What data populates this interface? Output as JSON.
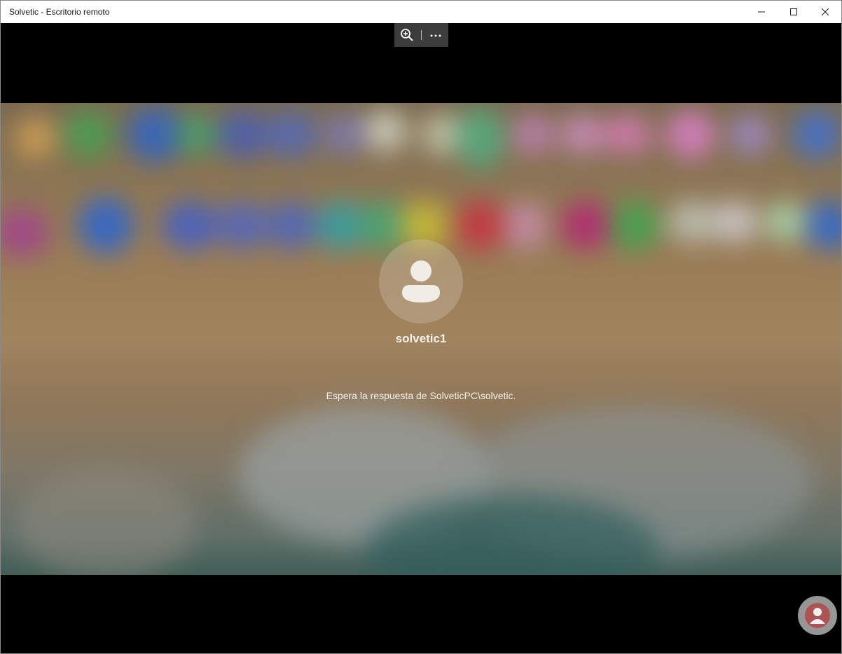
{
  "window": {
    "title": "Solvetic - Escritorio remoto",
    "controls": [
      {
        "name": "minimize",
        "icon": "minimize-icon"
      },
      {
        "name": "maximize",
        "icon": "maximize-icon"
      },
      {
        "name": "close",
        "icon": "close-icon"
      }
    ]
  },
  "remote_toolbar": {
    "zoom_icon": "zoom-in-icon",
    "more_icon": "more-options-icon"
  },
  "lockscreen": {
    "avatar_icon": "user-avatar-icon",
    "username": "solvetic1",
    "status_message": "Espera la respuesta de SolveticPC\\solvetic."
  },
  "colors": {
    "titlebar_bg": "#ffffff",
    "remote_toolbar_bg": "#3c3c3c",
    "text_light": "#f4f1ec"
  }
}
